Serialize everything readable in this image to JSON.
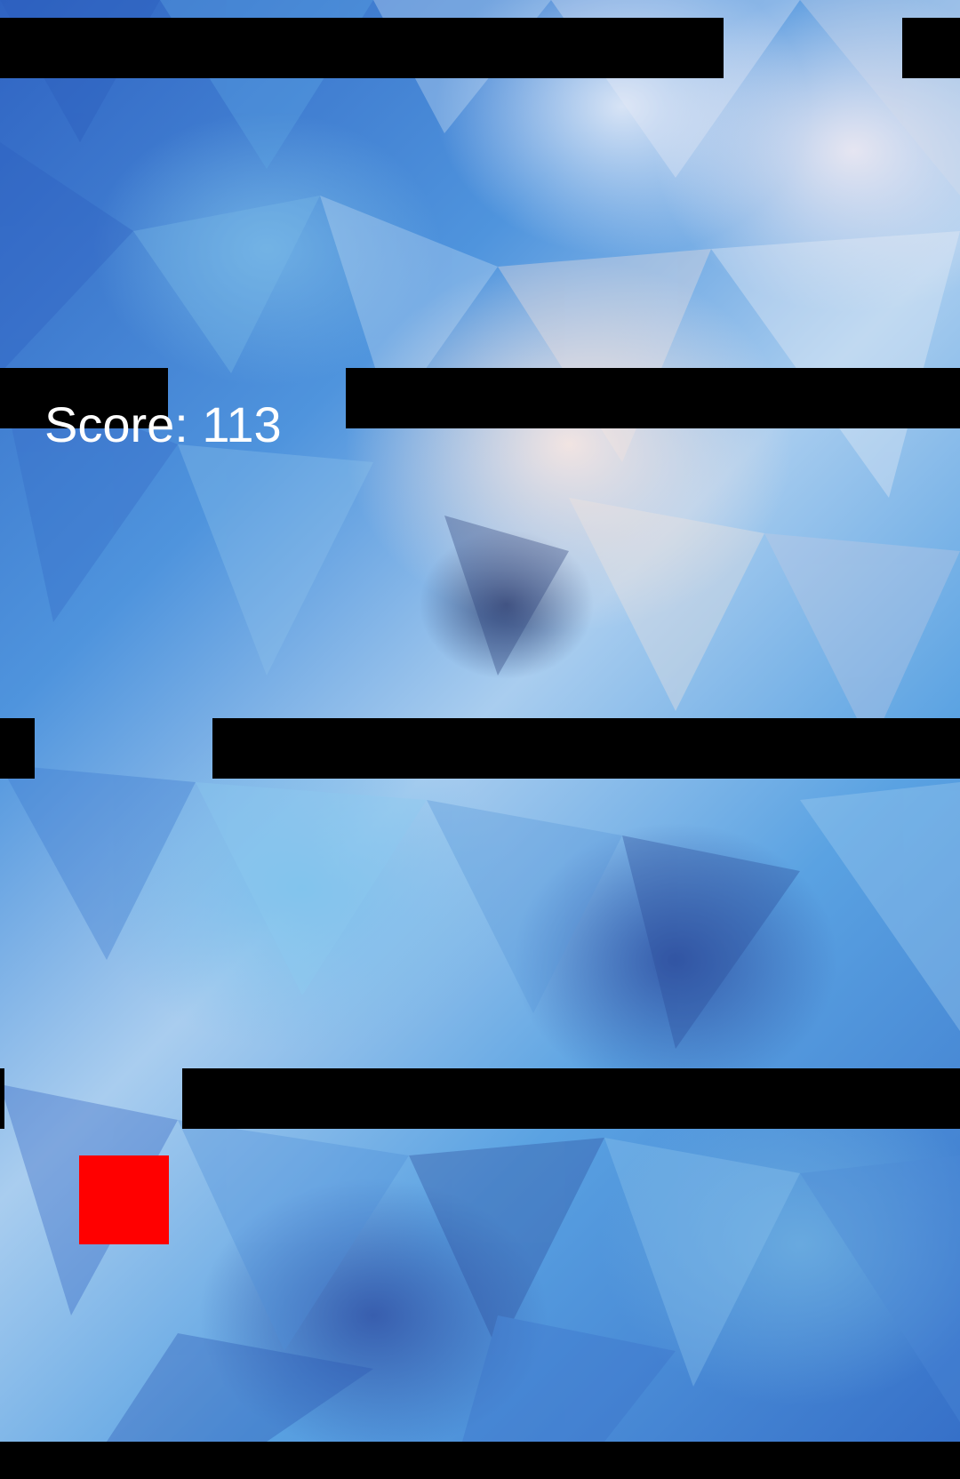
{
  "score": {
    "text": "Score: 113",
    "value": 113
  },
  "colors": {
    "player": "#ff0000",
    "obstacle": "#000000",
    "score_text": "#ffffff"
  },
  "icons": {
    "player": "red-square",
    "background": "low-poly-blue-texture"
  }
}
